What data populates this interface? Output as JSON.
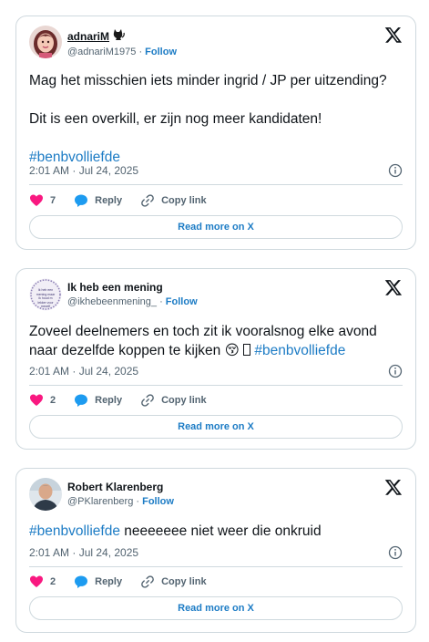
{
  "tweets": [
    {
      "display_name": "adnariM",
      "handle": "@adnariM1975",
      "follow_label": "Follow",
      "body_lines": [
        "Mag het misschien iets minder ingrid / JP per uitzending?",
        "Dit is een overkill, er zijn nog meer kandidaten!"
      ],
      "hashtag": "#benbvolliefde",
      "timestamp": "2:01 AM · Jul 24, 2025",
      "like_count": "7",
      "reply_label": "Reply",
      "copy_label": "Copy link",
      "read_more_label": "Read more on X"
    },
    {
      "display_name": "Ik heb een mening",
      "handle": "@ikhebeenmening_",
      "follow_label": "Follow",
      "body_text": "Zoveel deelnemers en toch zit ik vooralsnog elke avond naar dezelfde koppen te kijken",
      "emoji": "😚",
      "hashtag": "#benbvolliefde",
      "avatar_text": "Ik heb een mening maar ik houd m lekker voor mezelf",
      "timestamp": "2:01 AM · Jul 24, 2025",
      "like_count": "2",
      "reply_label": "Reply",
      "copy_label": "Copy link",
      "read_more_label": "Read more on X"
    },
    {
      "display_name": "Robert Klarenberg",
      "handle": "@PKlarenberg",
      "follow_label": "Follow",
      "hashtag": "#benbvolliefde",
      "body_text": " neeeeeee niet weer die onkruid",
      "timestamp": "2:01 AM · Jul 24, 2025",
      "like_count": "2",
      "reply_label": "Reply",
      "copy_label": "Copy link",
      "read_more_label": "Read more on X"
    }
  ],
  "separator": " · ",
  "colors": {
    "link": "#1d7cc5",
    "heart": "#f91880",
    "reply": "#1d9bf0",
    "border": "#cfd9de",
    "muted": "#536471"
  }
}
